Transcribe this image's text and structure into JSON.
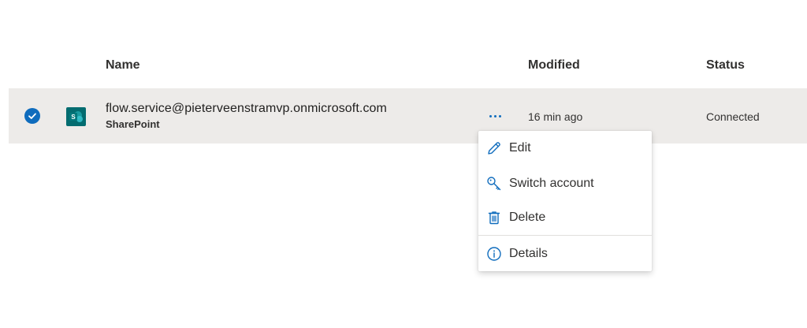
{
  "columns": {
    "name": "Name",
    "modified": "Modified",
    "status": "Status"
  },
  "row": {
    "title": "flow.service@pieterveenstramvp.onmicrosoft.com",
    "subtitle": "SharePoint",
    "modified": "16 min ago",
    "status": "Connected",
    "selected": true,
    "icon": "sharepoint-icon"
  },
  "context_menu": {
    "items": [
      {
        "label": "Edit",
        "icon": "pencil-icon"
      },
      {
        "label": "Switch account",
        "icon": "key-icon"
      },
      {
        "label": "Delete",
        "icon": "trash-icon"
      },
      {
        "label": "Details",
        "icon": "info-icon"
      }
    ]
  },
  "colors": {
    "accent": "#0f6cbd",
    "row_selected_bg": "#edebe9",
    "sharepoint": "#036c70"
  }
}
